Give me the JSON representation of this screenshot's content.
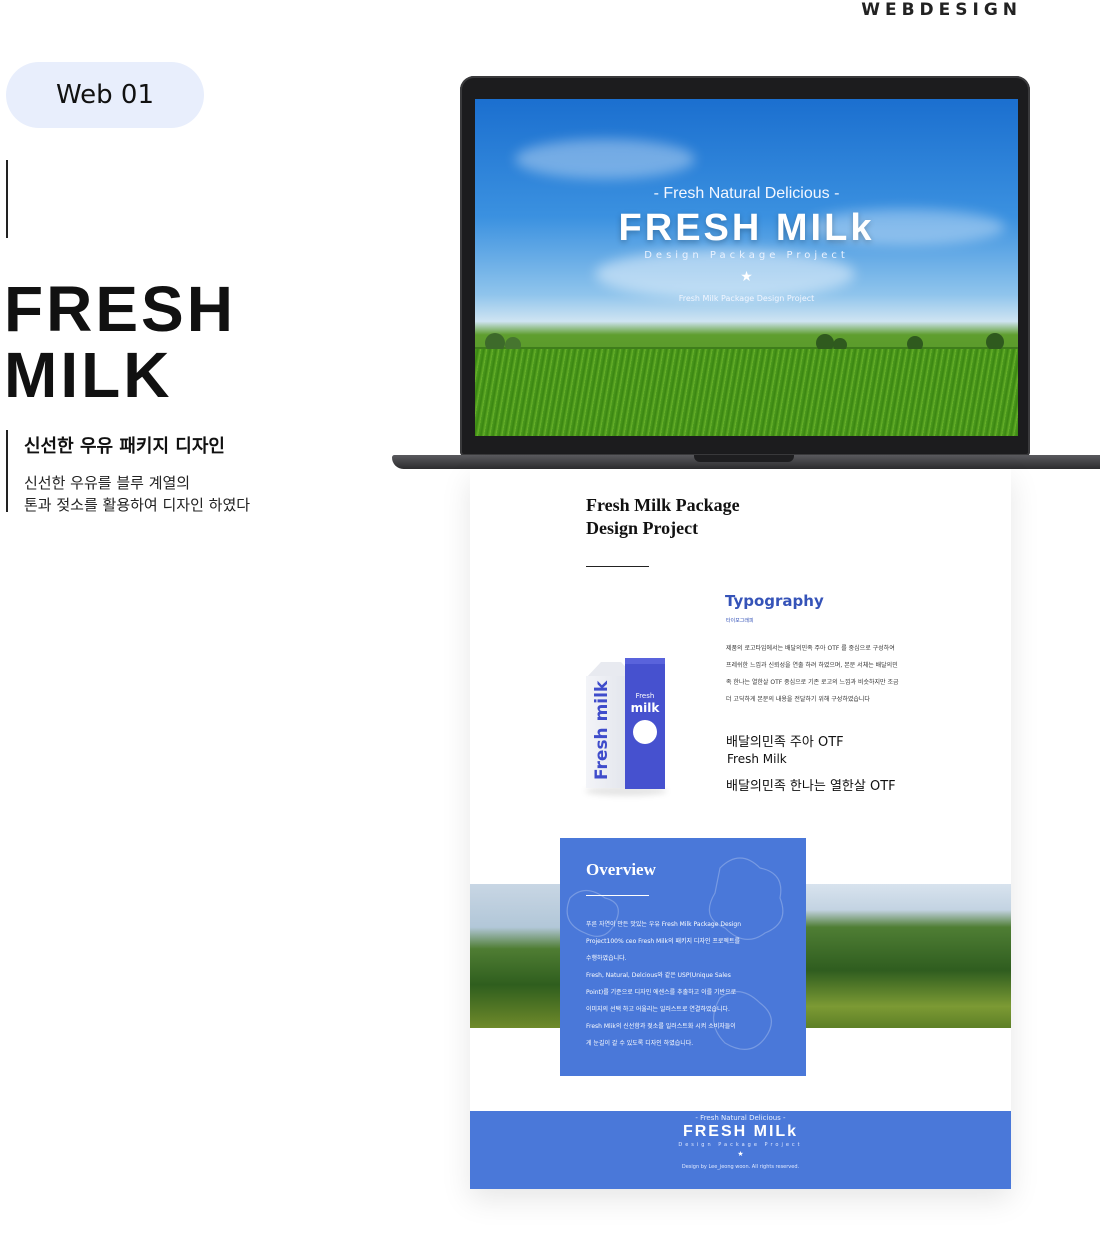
{
  "header": {
    "category": "WEBDESIGN"
  },
  "project": {
    "badge": "Web 01",
    "title_line1": "FRESH",
    "title_line2": "MILK",
    "subtitle": "신선한 우유 패키지 디자인",
    "desc_line1": "신선한 우유를 블루 계열의",
    "desc_line2": "톤과 젖소를 활용하여 디자인 하였다"
  },
  "screen": {
    "tagline": "- Fresh Natural Delicious -",
    "title": "FRESH MILk",
    "subtitle": "Design Package Project",
    "star": "★",
    "caption": "Fresh Milk Package Design Project"
  },
  "page": {
    "title_line1": "Fresh Milk Package",
    "title_line2": "Design Project",
    "typography": {
      "heading": "Typography",
      "sub": "타이포그래피",
      "body": "제품의 로고타입에서는 배달의민족 주아 OTF 를 중심으로 구성하여 프레쉬한 느낌과 신뢰성을 연출 하려 하였으며, 본문 서체는 배달의민족 한나는 열한살 OTF 중심으로 기존 로고의 느낌과 비슷하지만 조금 더 고딕하게 본문의 내용을 전달하기 위해 구성하였습니다",
      "font1": "배달의민족 주아 OTF",
      "font2": "Fresh Milk",
      "font3": "배달의민족 한나는 열한살 OTF"
    },
    "carton": {
      "brand": "Fresh milk",
      "label_small": "Fresh",
      "label_big": "milk"
    },
    "overview": {
      "heading": "Overview",
      "lines": [
        "푸른 자연이 만든 맛있는 우유 Fresh Milk Package Design",
        "Project100% ceo Fresh Milk의 패키지 디자인 프로젝트를",
        "수행하였습니다.",
        "Fresh, Natural, Delcious와 같은 USP(Unique Sales",
        "Point)를 기준으로 디자인 에센스를 추출하고 이를 기반으로",
        "이미지의 선택 하고 어울리는 일러스트로 연결하였습니다.",
        "Fresh Mlik의 신선함과 젖소를 일러스트화 시켜 소비자들이",
        "게 눈길이 갈 수 있도록 디자인 하였습니다."
      ]
    },
    "footer": {
      "tagline": "- Fresh Natural Delicious -",
      "title": "FRESH MILk",
      "subtitle": "Design Package Project",
      "star": "★",
      "copyright": "Design by Lee_jeong woon. All rights reserved."
    }
  },
  "colors": {
    "accent": "#4a78d9",
    "typography_blue": "#3553b8",
    "pill": "#e8eefc"
  }
}
